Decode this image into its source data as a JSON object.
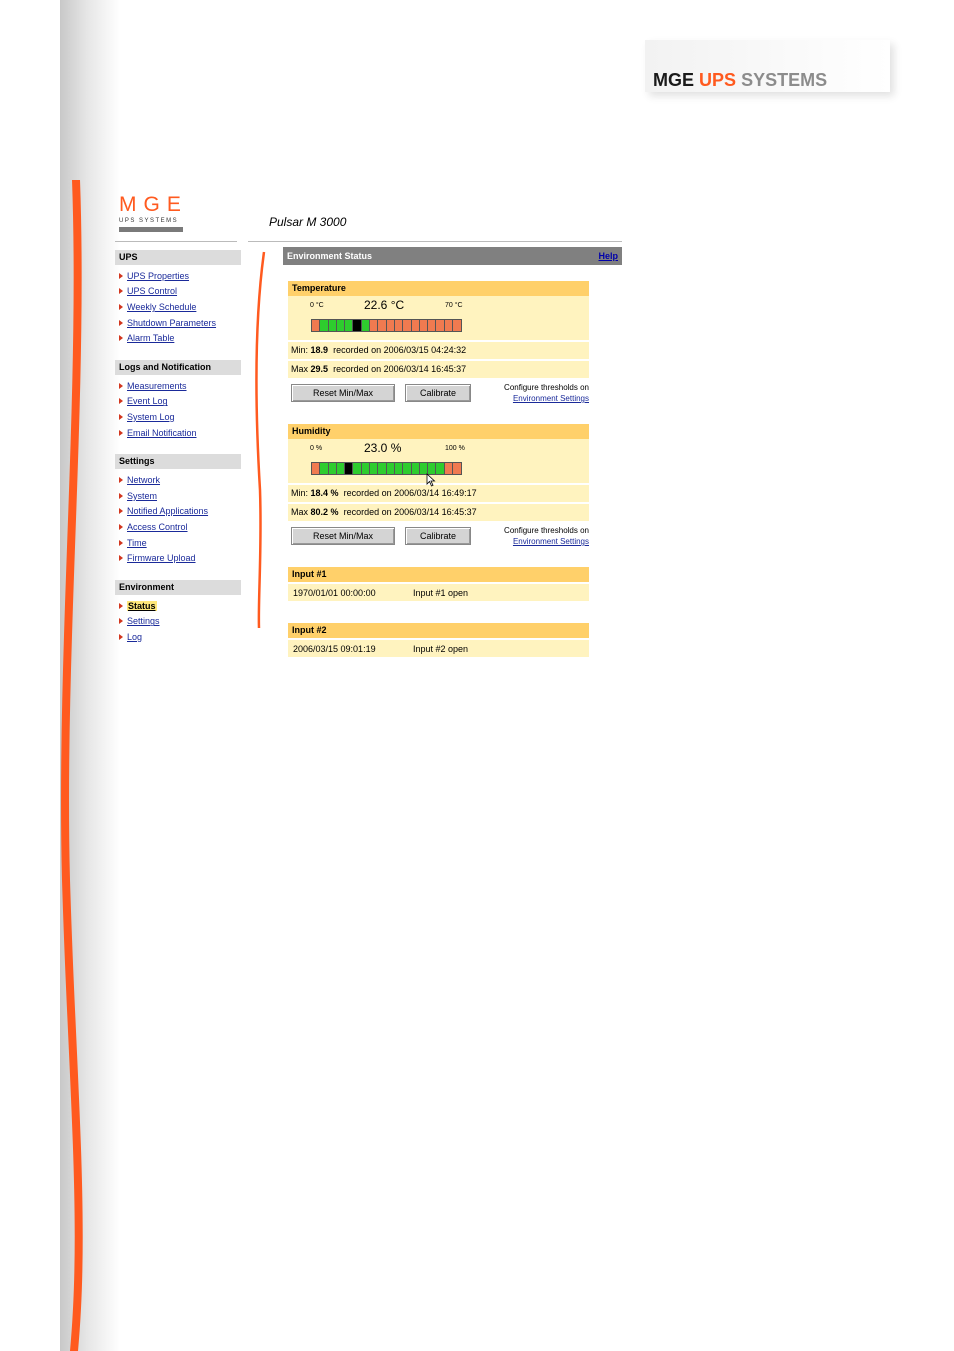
{
  "doc_brand": {
    "mge": "MGE",
    "ups": "UPS",
    "systems": "SYSTEMS"
  },
  "logo": {
    "main": "MGE",
    "sub": "UPS SYSTEMS"
  },
  "product_title": "Pulsar M 3000",
  "sidebar": {
    "groups": [
      {
        "heading": "UPS",
        "items": [
          "UPS Properties",
          "UPS Control",
          "Weekly Schedule",
          "Shutdown Parameters",
          "Alarm Table"
        ]
      },
      {
        "heading": "Logs and Notification",
        "items": [
          "Measurements",
          "Event Log",
          "System Log",
          "Email Notification"
        ]
      },
      {
        "heading": "Settings",
        "items": [
          "Network",
          "System",
          "Notified Applications",
          "Access Control",
          "Time",
          "Firmware Upload"
        ]
      },
      {
        "heading": "Environment",
        "items": [
          "Status",
          "Settings",
          "Log"
        ]
      }
    ]
  },
  "panel": {
    "title": "Environment Status",
    "help": "Help"
  },
  "temperature": {
    "heading": "Temperature",
    "min_scale": "0 °C",
    "value": "22.6 °C",
    "max_scale": "70 °C",
    "gauge_segments": [
      "r",
      "g",
      "g",
      "g",
      "g",
      "k",
      "g",
      "r",
      "r",
      "r",
      "r",
      "r",
      "r",
      "r",
      "r",
      "r",
      "r",
      "r"
    ],
    "min_label": "Min:",
    "min_value": "18.9",
    "min_recorded": "recorded on 2006/03/15 04:24:32",
    "max_label": "Max",
    "max_value": "29.5",
    "max_recorded": "recorded on 2006/03/14 16:45:37"
  },
  "humidity": {
    "heading": "Humidity",
    "min_scale": "0 %",
    "value": "23.0 %",
    "max_scale": "100 %",
    "gauge_segments": [
      "r",
      "g",
      "g",
      "g",
      "k",
      "g",
      "g",
      "g",
      "g",
      "g",
      "g",
      "g",
      "g",
      "g",
      "g",
      "g",
      "r",
      "r"
    ],
    "min_label": "Min:",
    "min_value": "18.4 %",
    "min_recorded": "recorded on 2006/03/14 16:49:17",
    "max_label": "Max",
    "max_value": "80.2 %",
    "max_recorded": "recorded on 2006/03/14 16:45:37"
  },
  "buttons": {
    "reset": "Reset Min/Max",
    "calibrate": "Calibrate"
  },
  "configure": {
    "text": "Configure thresholds on",
    "link": "Environment Settings"
  },
  "inputs": [
    {
      "heading": "Input #1",
      "date": "1970/01/01 00:00:00",
      "state": "Input #1 open"
    },
    {
      "heading": "Input #2",
      "date": "2006/03/15 09:01:19",
      "state": "Input #2 open"
    }
  ],
  "colors": {
    "accent_orange": "#ff5a1f",
    "section_header": "#ffd06a",
    "section_body": "#fff3bf",
    "gauge_green": "#2ecc2e",
    "gauge_red": "#f07a50",
    "gauge_marker": "#000000"
  }
}
